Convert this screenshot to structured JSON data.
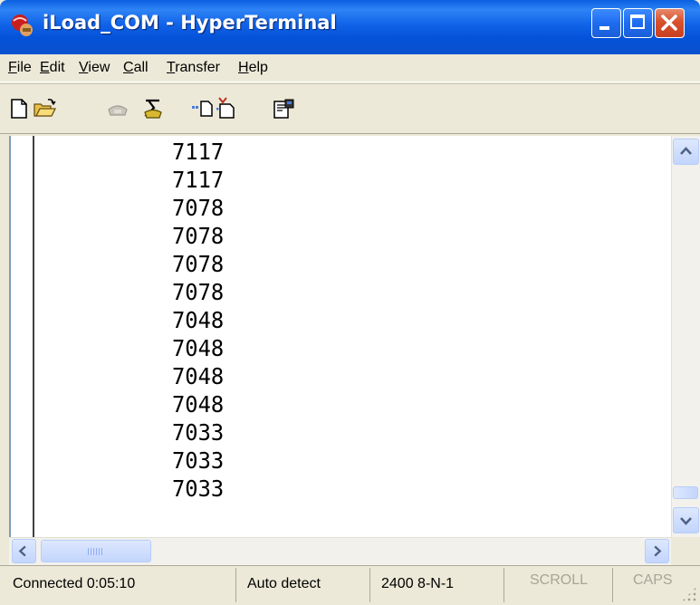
{
  "window": {
    "title": "iLoad_COM - HyperTerminal",
    "buttons": {
      "minimize": "minimize-icon",
      "maximize": "maximize-icon",
      "close": "close-icon"
    }
  },
  "menu": [
    {
      "label": "File",
      "mnemonic": "F"
    },
    {
      "label": "Edit",
      "mnemonic": "E"
    },
    {
      "label": "View",
      "mnemonic": "V"
    },
    {
      "label": "Call",
      "mnemonic": "C"
    },
    {
      "label": "Transfer",
      "mnemonic": "T"
    },
    {
      "label": "Help",
      "mnemonic": "H"
    }
  ],
  "toolbar": [
    {
      "icon": "new-document-icon"
    },
    {
      "icon": "open-folder-icon"
    },
    {
      "icon": "phone-disabled-icon"
    },
    {
      "icon": "disconnect-icon"
    },
    {
      "icon": "send-file-icon"
    },
    {
      "icon": "receive-file-icon"
    },
    {
      "icon": "properties-icon"
    }
  ],
  "terminal": {
    "lines": [
      "7117",
      "7117",
      "7078",
      "7078",
      "7078",
      "7078",
      "7048",
      "7048",
      "7048",
      "7048",
      "7033",
      "7033",
      "7033"
    ]
  },
  "status": {
    "connected": "Connected 0:05:10",
    "detect": "Auto detect",
    "settings": "2400 8-N-1",
    "scroll": "SCROLL",
    "caps": "CAPS"
  },
  "colors": {
    "titlebar": "#0a5fe0",
    "close_button": "#d8512d",
    "window_face": "#ece9d8",
    "terminal_bg": "#ffffff"
  }
}
